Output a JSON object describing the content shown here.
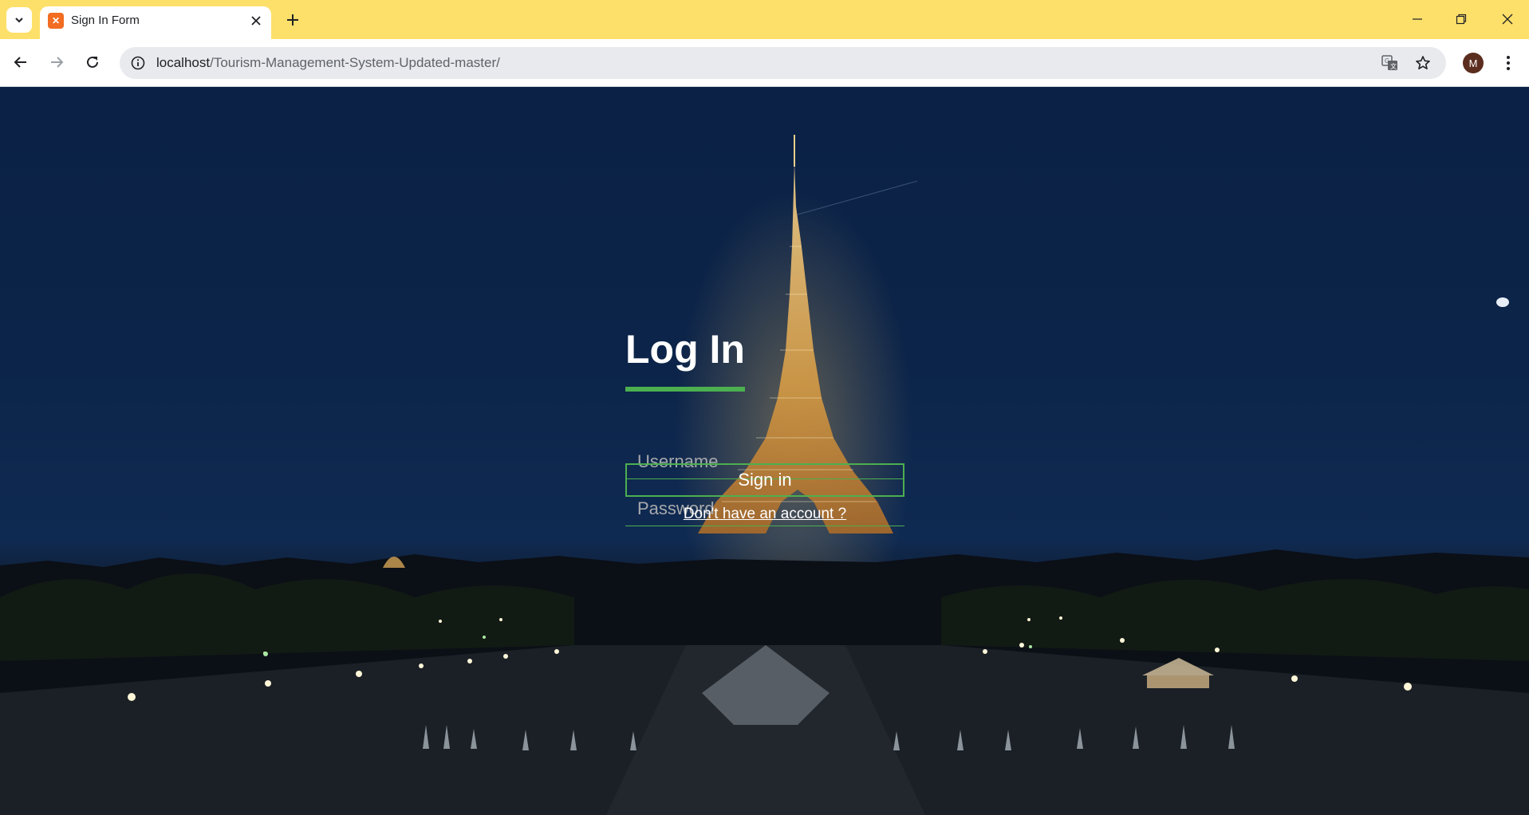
{
  "browser": {
    "tab": {
      "title": "Sign In Form"
    },
    "address_bar": {
      "host": "localhost",
      "path": "/Tourism-Management-System-Updated-master/"
    },
    "profile_initial": "M"
  },
  "login": {
    "title": "Log In",
    "username_placeholder": "Username",
    "password_placeholder": "Password",
    "sign_in_label": "Sign in",
    "signup_link_label": "Don't have an account ?"
  },
  "colors": {
    "accent_green": "#4caf50",
    "titlebar": "#fde06a"
  }
}
